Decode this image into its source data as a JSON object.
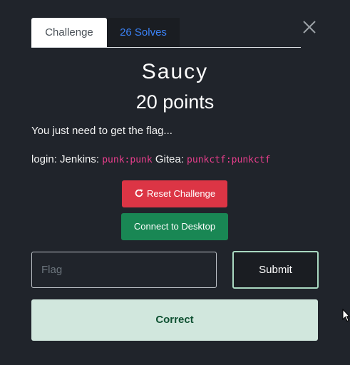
{
  "tabs": [
    {
      "label": "Challenge"
    },
    {
      "label": "26 Solves"
    }
  ],
  "challenge": {
    "name": "Saucy",
    "points": "20 points",
    "description": "You just need to get the flag...",
    "login": {
      "prefix": "login: Jenkins: ",
      "jenkins_cred": "punk:punk",
      "gitea_label": " Gitea: ",
      "gitea_cred": "punkctf:punkctf"
    }
  },
  "buttons": {
    "reset": "Reset Challenge",
    "desktop": "Connect to Desktop",
    "submit": "Submit"
  },
  "flag_input": {
    "placeholder": "Flag",
    "value": ""
  },
  "result": {
    "message": "Correct"
  },
  "colors": {
    "background": "#20242b",
    "reset": "#dc3545",
    "desktop": "#198754",
    "correct_bg": "#d1e7dd",
    "correct_text": "#0f5132",
    "code": "#e83e8c",
    "tab_link": "#3b82f6"
  },
  "icons": {
    "close": "close-icon",
    "reset": "refresh-icon"
  }
}
